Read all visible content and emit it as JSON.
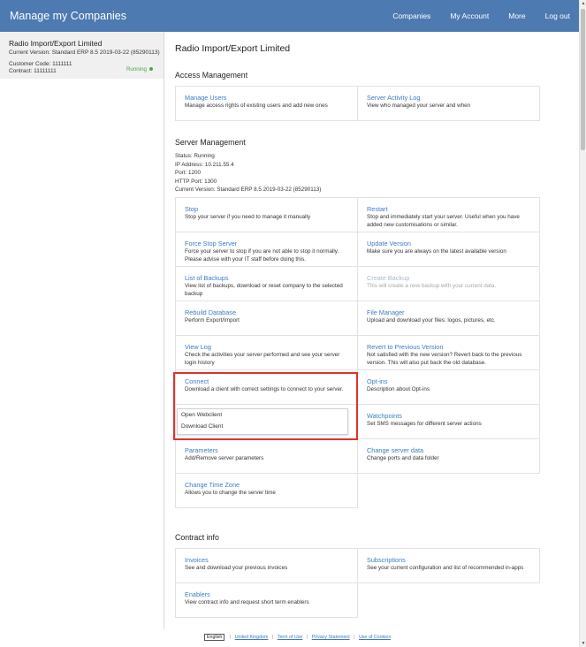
{
  "header": {
    "title": "Manage my Companies",
    "nav": [
      "Companies",
      "My Account",
      "More",
      "Log out"
    ]
  },
  "sidebar": {
    "company_name": "Radio Import/Export Limited",
    "current_version": "Current Version: Standard ERP 8.5 2019-03-22 (85290113)",
    "customer_code": "Customer Code: 1111111",
    "contract": "Contract: 11111111",
    "status": "Running"
  },
  "main": {
    "title": "Radio Import/Export Limited",
    "access": {
      "heading": "Access Management",
      "cards": [
        {
          "title": "Manage Users",
          "desc": "Manage access rights of existing users and add new ones"
        },
        {
          "title": "Server Activity Log",
          "desc": "View who managed your server and when"
        }
      ]
    },
    "server": {
      "heading": "Server Management",
      "status_lines": [
        "Status: Running",
        "IP Address: 10.211.55.4",
        "Port: 1200",
        "HTTP Port: 1300",
        "Current Version: Standard ERP 8.5 2019-03-22 (85290113)"
      ],
      "cards": [
        {
          "title": "Stop",
          "desc": "Stop your server if you need to manage it manually"
        },
        {
          "title": "Restart",
          "desc": "Stop and immediately start your server. Useful when you have added new customisations or similar."
        },
        {
          "title": "Force Stop Server",
          "desc": "Force your server to stop if you are not able to stop it normally. Please advise with your IT staff before doing this."
        },
        {
          "title": "Update Version",
          "desc": "Make sure you are always on the latest available version"
        },
        {
          "title": "List of Backups",
          "desc": "View list of backups, download or reset company to the selected backup"
        },
        {
          "title": "Create Backup",
          "desc": "This will create a new backup with your current data."
        },
        {
          "title": "Rebuild Database",
          "desc": "Perform Export/Import"
        },
        {
          "title": "File Manager",
          "desc": "Upload and download your files: logos, pictures, etc."
        },
        {
          "title": "View Log",
          "desc": "Check the activities your server performed and see your server login history"
        },
        {
          "title": "Revert to Previous Version",
          "desc": "Not satisfied with the new version? Revert back to the previous version. This will also put back the old database."
        },
        {
          "title": "Connect",
          "desc": "Download a client with correct settings to connect to your server."
        },
        {
          "title": "Opt-ins",
          "desc": "Description about Opt-ins"
        },
        {
          "title": "Watchpoints",
          "desc": "Set SMS messages for different server actions"
        },
        {
          "title": "Parameters",
          "desc": "Add/Remove server parameters"
        },
        {
          "title": "Change server data",
          "desc": "Change ports and data folder"
        },
        {
          "title": "Change Time Zone",
          "desc": "Allows you to change the server time"
        }
      ],
      "connect_options": [
        "Open Webclient",
        "Download Client"
      ]
    },
    "contract": {
      "heading": "Contract info",
      "cards": [
        {
          "title": "Invoices",
          "desc": "See and download your previous invoices"
        },
        {
          "title": "Subscriptions",
          "desc": "See your current configuration and list of recommended in-apps"
        },
        {
          "title": "Enablers",
          "desc": "View contract info and request short term enablers"
        }
      ]
    }
  },
  "footer": {
    "language": "English",
    "links": [
      "United Kingdom",
      "Term of Use",
      "Privacy Statement",
      "Use of Cookies"
    ]
  },
  "colors": {
    "header_bg": "#4d7ab0",
    "link": "#3a7bc8",
    "running": "#4aa84a",
    "highlight": "#e03030"
  }
}
